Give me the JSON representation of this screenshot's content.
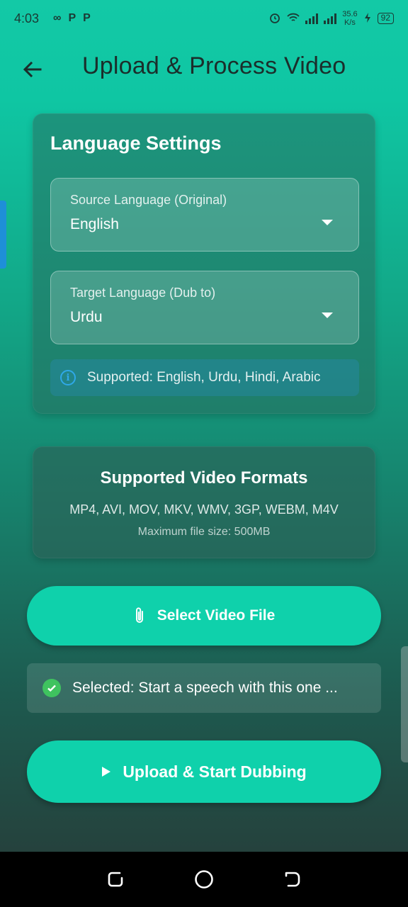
{
  "status_bar": {
    "time": "4:03",
    "app_icons": [
      "∞",
      "P",
      "P"
    ],
    "network_speed_value": "35.6",
    "network_speed_unit": "K/s",
    "battery": "92"
  },
  "header": {
    "title": "Upload & Process Video",
    "back_icon": "arrow-left-icon"
  },
  "language_settings": {
    "title": "Language Settings",
    "source": {
      "label": "Source Language (Original)",
      "value": "English"
    },
    "target": {
      "label": "Target Language (Dub to)",
      "value": "Urdu"
    },
    "info": "Supported: English, Urdu, Hindi, Arabic"
  },
  "formats": {
    "title": "Supported Video Formats",
    "list": "MP4, AVI, MOV, MKV, WMV, 3GP, WEBM, M4V",
    "max_size": "Maximum file size: 500MB"
  },
  "select_button": {
    "label": "Select Video File",
    "icon": "paperclip-icon"
  },
  "selected_file": {
    "text": "Selected: Start a speech with this one ..."
  },
  "upload_button": {
    "label": "Upload & Start Dubbing",
    "icon": "play-icon"
  },
  "colors": {
    "accent": "#0fd1ab",
    "info": "#2fa8e8",
    "success": "#3fc35f"
  }
}
